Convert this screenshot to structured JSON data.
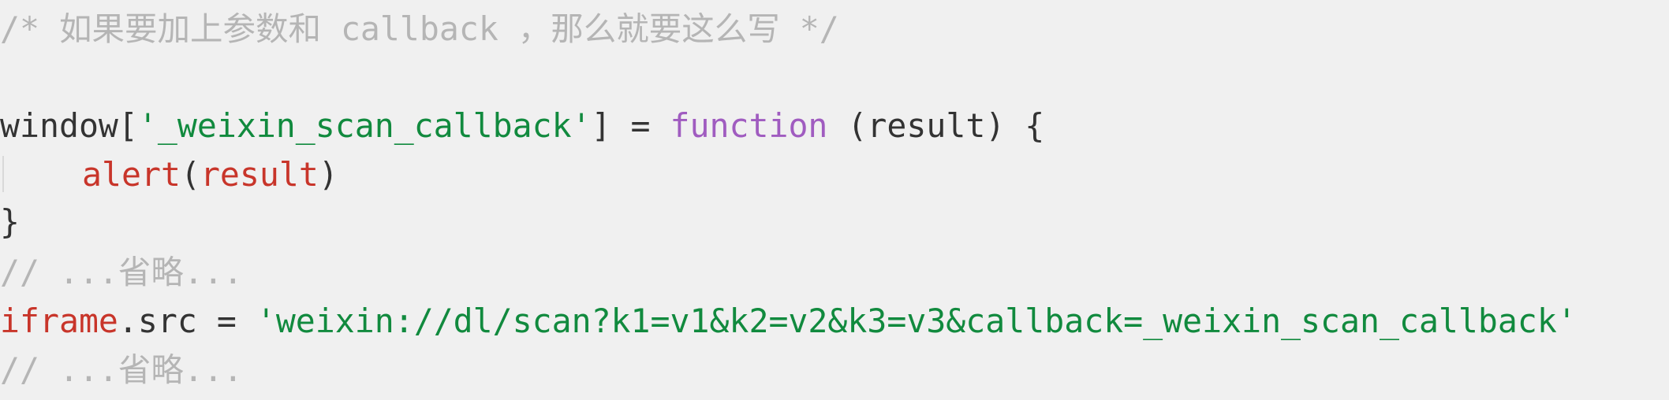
{
  "code": {
    "line1": {
      "comment": "/* 如果要加上参数和 callback ，那么就要这么写 */"
    },
    "line3": {
      "obj": "window[",
      "key": "'_weixin_scan_callback'",
      "rest1": "] = ",
      "keyword": "function",
      "rest2": " (result) {"
    },
    "line4": {
      "fn": "alert",
      "paren_open": "(",
      "arg": "result",
      "paren_close": ")"
    },
    "line5": {
      "brace": "}"
    },
    "line6": {
      "comment": "// ...省略..."
    },
    "line7": {
      "obj": "iframe",
      "prop": ".src = ",
      "value": "'weixin://dl/scan?k1=v1&k2=v2&k3=v3&callback=_weixin_scan_callback'"
    },
    "line8": {
      "comment": "// ...省略..."
    }
  }
}
